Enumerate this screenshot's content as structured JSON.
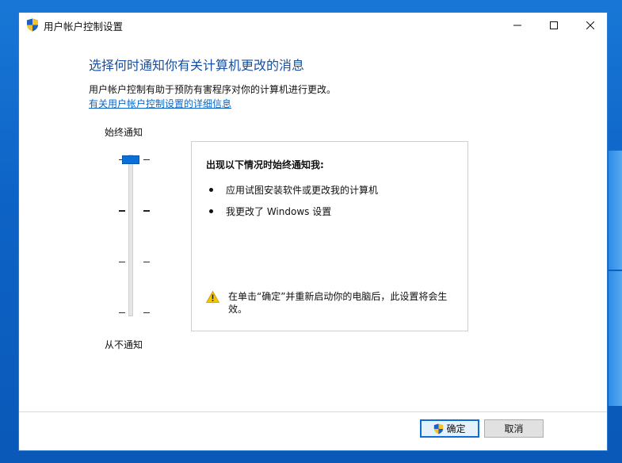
{
  "window": {
    "title": "用户帐户控制设置",
    "title_icon": "uac-shield-icon",
    "controls": {
      "minimize": "minimize-icon",
      "maximize": "maximize-icon",
      "close": "close-icon"
    }
  },
  "main": {
    "heading": "选择何时通知你有关计算机更改的消息",
    "description": "用户帐户控制有助于预防有害程序对你的计算机进行更改。",
    "link": "有关用户帐户控制设置的详细信息"
  },
  "slider": {
    "top_label": "始终通知",
    "bottom_label": "从不通知",
    "levels": 4,
    "selected_level": 4
  },
  "info": {
    "title": "出现以下情况时始终通知我:",
    "items": [
      "应用试图安装软件或更改我的计算机",
      "我更改了 Windows 设置"
    ],
    "warning_icon": "warning-icon",
    "warning": "在单击“确定”并重新启动你的电脑后，此设置将会生效。"
  },
  "buttons": {
    "ok": "确定",
    "cancel": "取消"
  },
  "colors": {
    "accent": "#0a6fd6",
    "heading": "#1a4fa0",
    "link": "#0a66c8"
  }
}
